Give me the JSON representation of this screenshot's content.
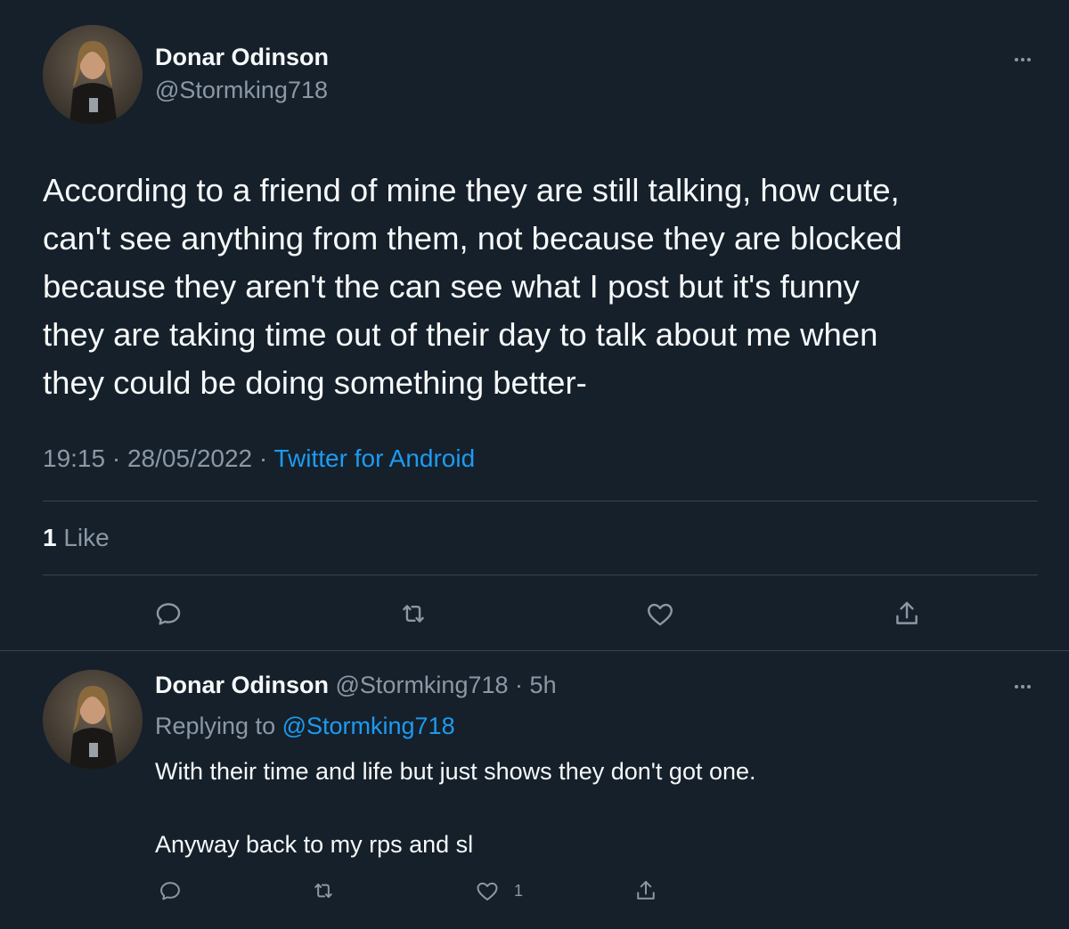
{
  "main_tweet": {
    "author_name": "Donar Odinson",
    "author_handle": "@Stormking718",
    "text_lines": [
      "According to a friend of mine they are still talking, how cute,",
      "can't see anything from them, not because they are blocked",
      "because they aren't the can see what I post but it's funny",
      "they are taking time out of their day to talk about me when",
      "they could be doing something better-"
    ],
    "time": "19:15",
    "date": "28/05/2022",
    "separator": "·",
    "source": "Twitter for Android",
    "like_count": "1",
    "like_label": "Like",
    "icons": [
      "more-icon",
      "reply-icon",
      "retweet-icon",
      "like-icon",
      "share-icon"
    ]
  },
  "reply_tweet": {
    "author_name": "Donar Odinson",
    "author_handle": "@Stormking718",
    "separator": "·",
    "age": "5h",
    "replying_prefix": "Replying to",
    "replying_to": "@Stormking718",
    "text_line_1": "With their time and life but just shows they don't got one.",
    "text_line_2": "Anyway back to my rps and sl",
    "like_count": "1",
    "icons": [
      "more-icon",
      "reply-icon",
      "retweet-icon",
      "like-icon",
      "share-icon"
    ]
  },
  "colors": {
    "background": "#15202b",
    "primary_text": "#f7f9f9",
    "secondary_text": "#8b98a5",
    "link": "#1d9bf0",
    "divider": "#38444d"
  }
}
